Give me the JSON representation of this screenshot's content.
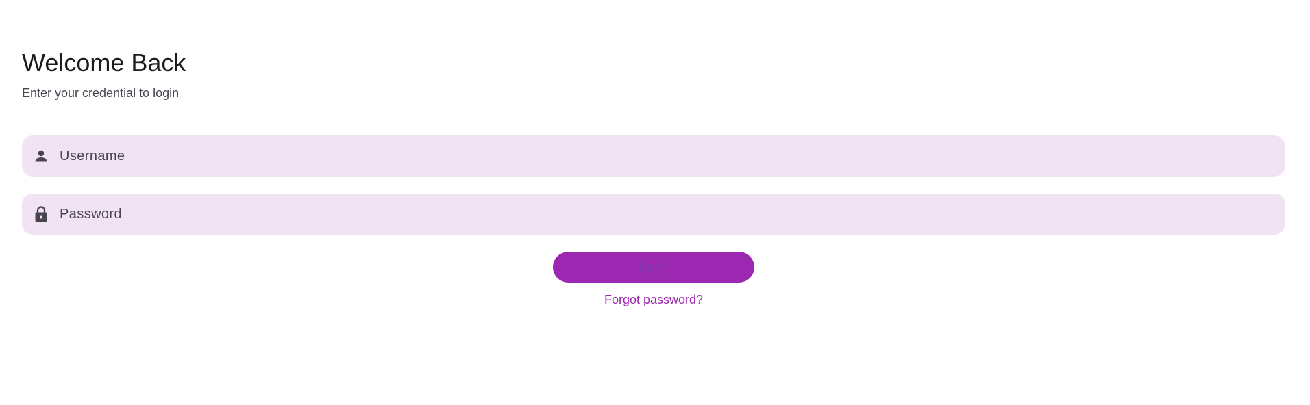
{
  "header": {
    "title": "Welcome Back",
    "subtitle": "Enter your credential to login"
  },
  "form": {
    "username": {
      "placeholder": "Username",
      "value": "",
      "icon": "person-icon"
    },
    "password": {
      "placeholder": "Password",
      "value": "",
      "icon": "lock-icon"
    },
    "login_label": "Login",
    "forgot_label": "Forgot password?"
  },
  "colors": {
    "accent": "#9c27b0",
    "field_background": "#f2e3f4",
    "text_primary": "#1d1b20",
    "text_secondary": "#49454f"
  }
}
